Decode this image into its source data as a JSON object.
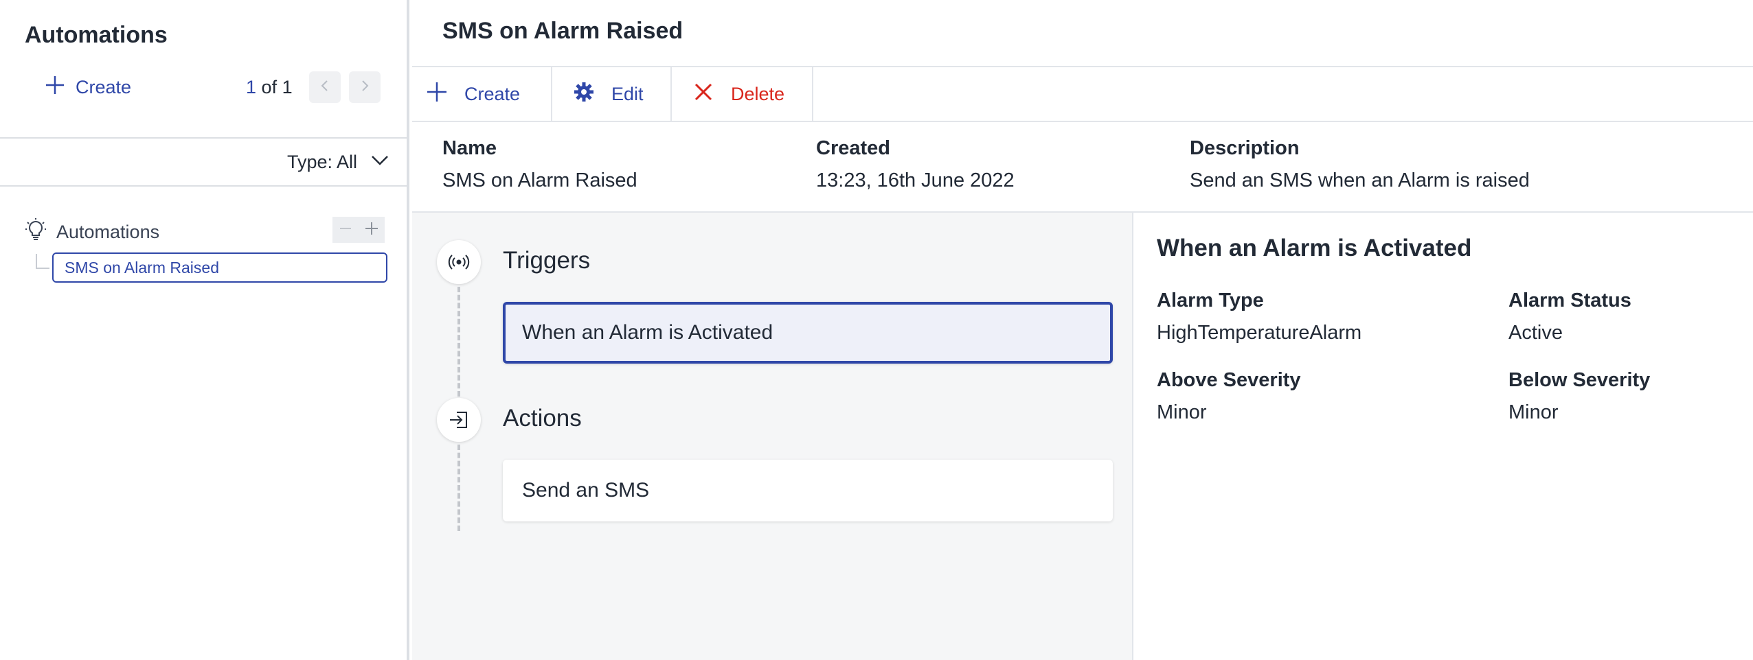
{
  "sidebar": {
    "title": "Automations",
    "create_label": "Create",
    "pager": {
      "current": "1",
      "total_text": "of 1"
    },
    "type_filter": "Type: All",
    "tree": {
      "root_label": "Automations",
      "items": [
        {
          "label": "SMS on Alarm Raised",
          "selected": true
        }
      ]
    }
  },
  "main": {
    "title": "SMS on Alarm Raised",
    "toolbar": {
      "create": "Create",
      "edit": "Edit",
      "delete": "Delete"
    },
    "details": {
      "name_label": "Name",
      "name_value": "SMS on Alarm Raised",
      "created_label": "Created",
      "created_value": "13:23, 16th June 2022",
      "description_label": "Description",
      "description_value": "Send an SMS when an Alarm is raised"
    },
    "flow": {
      "triggers_title": "Triggers",
      "trigger_card": "When an Alarm is Activated",
      "actions_title": "Actions",
      "action_card": "Send an SMS"
    },
    "panel": {
      "title": "When an Alarm is Activated",
      "alarm_type_label": "Alarm Type",
      "alarm_type_value": "HighTemperatureAlarm",
      "alarm_status_label": "Alarm Status",
      "alarm_status_value": "Active",
      "above_label": "Above Severity",
      "above_value": "Minor",
      "below_label": "Below Severity",
      "below_value": "Minor"
    }
  },
  "colors": {
    "accent": "#2f47a8",
    "danger": "#d9261c",
    "canvas_bg": "#f5f6f7"
  },
  "icons": [
    "plus-icon",
    "chevron-left-icon",
    "chevron-right-icon",
    "chevron-down-icon",
    "lightbulb-icon",
    "minus-icon",
    "gear-icon",
    "close-icon",
    "broadcast-icon",
    "login-icon"
  ]
}
